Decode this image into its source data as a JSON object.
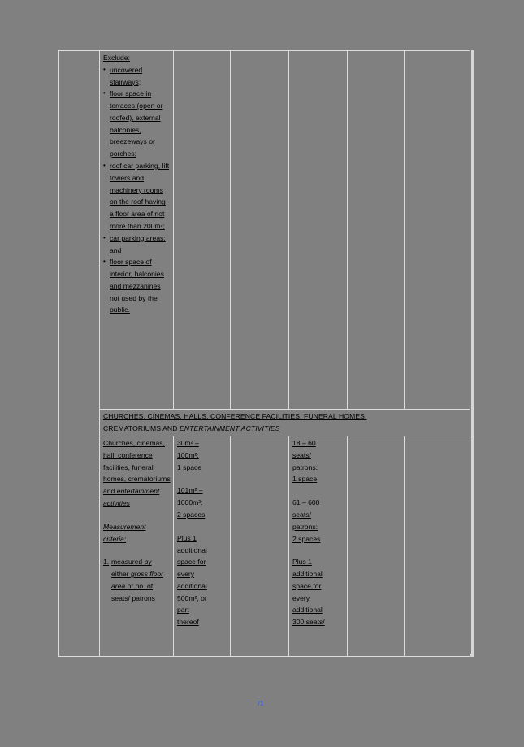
{
  "document": {
    "page_number": "71",
    "background_color": "#808080",
    "margin_column_color": "#e4ecdd",
    "table": {
      "columns": 7,
      "rows": [
        {
          "id": "exclude-row",
          "type": "content",
          "cells": {
            "col1_exclude": {
              "lead_in": "Exclude:",
              "bullets": [
                "uncovered stairways;",
                "floor space in terraces (open or roofed), external balconies, breezeways or porches;",
                "roof car parking, lift towers and machinery rooms on the roof having a floor area of not more than 200m²;",
                "car parking areas; and",
                "floor space of interior, balconies and mezzanines not used by the public."
              ],
              "bullet_marker": "•"
            },
            "col2": "",
            "col3": "",
            "col4": "",
            "col5": "",
            "col6": ""
          }
        },
        {
          "id": "section-heading-row",
          "type": "section-heading",
          "text_line1": "CHURCHES, CINEMAS, HALLS, CONFERENCE FACILITIES, FUNERAL HOMES,",
          "text_line2_normal": "CREMATORIUMS AND ",
          "text_line2_italic": "ENTERTAINMENT ACTIVITIES"
        },
        {
          "id": "churches-row",
          "type": "content",
          "cells": {
            "use_column": {
              "title_normal": "Churches, cinemas, hall, conference facilities, funeral homes, crematoriums and ",
              "title_italic": "entertainment activities",
              "criteria_heading": "Measurement criteria:",
              "criteria_items": [
                {
                  "number": "1.",
                  "text_before": "measured by either ",
                  "text_italic": "gross floor area ",
                  "text_after": "or no. of seats/ patrons"
                }
              ]
            },
            "gfa_column": {
              "band1": [
                "30m² –",
                "100m²:",
                "1 space"
              ],
              "band2": [
                "101m² –",
                "1000m²:",
                "2 spaces"
              ],
              "band3": [
                "Plus 1",
                "additional",
                "space for",
                "every",
                "additional",
                "500m², or",
                "part",
                "thereof"
              ]
            },
            "blank_column_3": "",
            "seats_column": {
              "band1": [
                "18 – 60",
                "seats/",
                "patrons:",
                "1 space"
              ],
              "band2": [
                "61 – 600",
                "seats/",
                "patrons:",
                "2 spaces"
              ],
              "band3": [
                "Plus 1",
                "additional",
                "space for",
                "every",
                "additional",
                "300 seats/"
              ]
            },
            "blank_column_5": "",
            "blank_column_6": ""
          }
        }
      ]
    }
  }
}
